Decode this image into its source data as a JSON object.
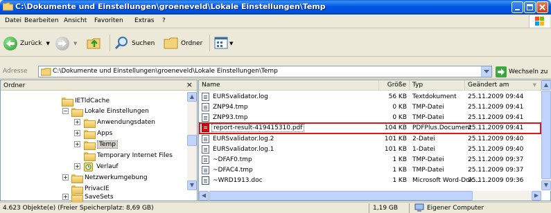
{
  "window": {
    "title": "C:\\Dokumente und Einstellungen\\groeneveld\\Lokale Einstellungen\\Temp"
  },
  "menu": [
    "Datei",
    "Bearbeiten",
    "Ansicht",
    "Favoriten",
    "Extras",
    "?"
  ],
  "toolbar": {
    "back_label": "Zurück",
    "search_label": "Suchen",
    "folders_label": "Ordner"
  },
  "address": {
    "label": "Adresse",
    "value": "C:\\Dokumente und Einstellungen\\groeneveld\\Lokale Einstellungen\\Temp",
    "go_label": "Wechseln zu"
  },
  "folder_pane": {
    "title": "Ordner",
    "close_glyph": "×",
    "items": [
      {
        "label": "IETldCache",
        "expander": ""
      },
      {
        "label": "Lokale Einstellungen",
        "expander": "−"
      },
      {
        "label": "Anwendungsdaten",
        "expander": "+"
      },
      {
        "label": "Apps",
        "expander": "+"
      },
      {
        "label": "Temp",
        "expander": "+",
        "selected": true
      },
      {
        "label": "Temporary Internet Files",
        "expander": ""
      },
      {
        "label": "Verlauf",
        "expander": "+"
      },
      {
        "label": "Netzwerkumgebung",
        "expander": "+"
      },
      {
        "label": "PrivacIE",
        "expander": ""
      },
      {
        "label": "SaveSets",
        "expander": "+"
      }
    ]
  },
  "file_list": {
    "columns": {
      "name": "Name",
      "size": "Größe",
      "type": "Typ",
      "modified": "Geändert am"
    },
    "rows": [
      {
        "name": "EURSvalidator.log",
        "size": "56 KB",
        "type": "Textdokument",
        "modified": "25.11.2009 09:44",
        "icon": "text"
      },
      {
        "name": "ZNP94.tmp",
        "size": "0 KB",
        "type": "TMP-Datei",
        "modified": "25.11.2009 09:41",
        "icon": "file"
      },
      {
        "name": "ZNP93.tmp",
        "size": "0 KB",
        "type": "TMP-Datei",
        "modified": "25.11.2009 09:41",
        "icon": "file"
      },
      {
        "name": "report-result-419415310.pdf",
        "size": "104 KB",
        "type": "PDFPlus.Document",
        "modified": "25.11.2009 09:41",
        "icon": "pdf"
      },
      {
        "name": "EURSvalidator.log.2",
        "size": "101 KB",
        "type": "2-Datei",
        "modified": "25.11.2009 09:40",
        "icon": "file"
      },
      {
        "name": "EURSvalidator.log.1",
        "size": "101 KB",
        "type": "1-Datei",
        "modified": "25.11.2009 09:40",
        "icon": "file"
      },
      {
        "name": "~DFAF0.tmp",
        "size": "1 KB",
        "type": "TMP-Datei",
        "modified": "25.11.2009 09:37",
        "icon": "file"
      },
      {
        "name": "~DFAC4.tmp",
        "size": "1 KB",
        "type": "TMP-Datei",
        "modified": "25.11.2009 09:37",
        "icon": "file"
      },
      {
        "name": "~WRD1913.doc",
        "size": "1 KB",
        "type": "Microsoft Word-Dok...",
        "modified": "25.11.2009 09:36",
        "icon": "doc"
      }
    ]
  },
  "status": {
    "objects": "4.623 Objekte(e) (Freier Speicherplatz: 8,69 GB)",
    "size": "1,19 GB",
    "zone": "Eigener Computer"
  },
  "colors": {
    "titlebar": "#0054e3",
    "highlight": "#e0141b"
  }
}
